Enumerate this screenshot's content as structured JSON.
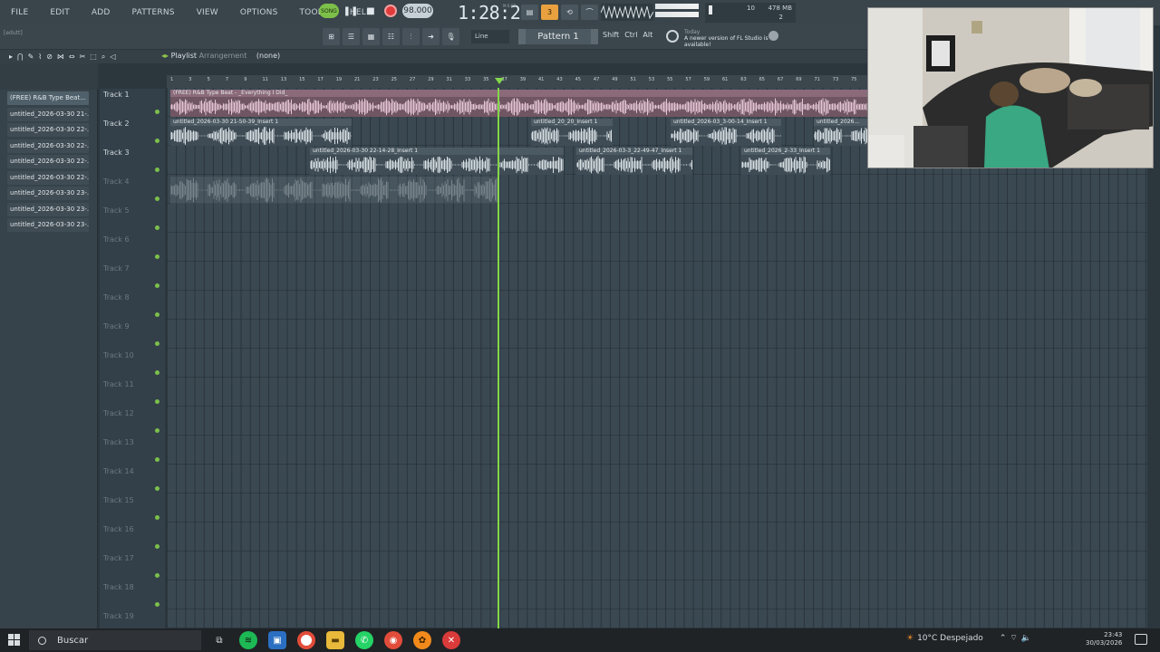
{
  "menu": [
    "FILE",
    "EDIT",
    "ADD",
    "PATTERNS",
    "VIEW",
    "OPTIONS",
    "TOOLS",
    "HELP"
  ],
  "transport": {
    "song_label": "SONG",
    "tempo": "98.000",
    "time": "1:28:27",
    "time_sub": "M:S:CS"
  },
  "cpu": {
    "cpu_value": "10",
    "memory": "478 MB",
    "polyphony": "2"
  },
  "hint_text": "[edutt]",
  "toolbar": {
    "line_mode": "Line",
    "pattern": "Pattern 1",
    "shift": "Shift",
    "ctrl": "Ctrl",
    "alt": "Alt"
  },
  "news": {
    "today": "Today",
    "message": "A newer version of FL Studio is available!"
  },
  "playlist": {
    "title": "Playlist",
    "subtitle": "Arrangement",
    "selection": "(none)"
  },
  "picker": [
    "(FREE) R&B Type Beat...",
    "untitled_2026-03-30 21-...",
    "untitled_2026-03-30 22-...",
    "untitled_2026-03-30 22-...",
    "untitled_2026-03-30 22-...",
    "untitled_2026-03-30 22-...",
    "untitled_2026-03-30 23-...",
    "untitled_2026-03-30 23-...",
    "untitled_2026-03-30 23-..."
  ],
  "tracks": [
    "Track 1",
    "Track 2",
    "Track 3",
    "Track 4",
    "Track 5",
    "Track 6",
    "Track 7",
    "Track 8",
    "Track 9",
    "Track 10",
    "Track 11",
    "Track 12",
    "Track 13",
    "Track 14",
    "Track 15",
    "Track 16",
    "Track 17",
    "Track 18",
    "Track 19"
  ],
  "ruler": [
    "1",
    "3",
    "5",
    "7",
    "9",
    "11",
    "13",
    "15",
    "17",
    "19",
    "21",
    "23",
    "25",
    "27",
    "29",
    "31",
    "33",
    "35",
    "37",
    "39",
    "41",
    "43",
    "45",
    "47",
    "49",
    "51",
    "53",
    "55",
    "57",
    "59",
    "61",
    "63",
    "65",
    "67",
    "69",
    "71",
    "73",
    "75"
  ],
  "clips": {
    "t1": "(FREE) R&B Type Beat - _Everything I Did_",
    "t2a": "untitled_2026-03-30 21-50-39_Insert 1",
    "t2b": "untitled_20_20_Insert 1",
    "t2c": "untitled_2026-03_3-00-14_Insert 1",
    "t2d": "untitled_2026...",
    "t3a": "untitled_2026-03-30 22-14-28_Insert 1",
    "t3b": "untitled_2026-03-3_22-49-47_Insert 1",
    "t3c": "untitled_2026_2-33_Insert 1"
  },
  "taskbar": {
    "search": "Buscar",
    "weather": "10°C  Despejado",
    "time": "23:43",
    "date": "30/03/2026"
  },
  "colors": {
    "accent_green": "#84d84a",
    "record_red": "#e23b3b",
    "clip_pink": "#8b6a7a"
  }
}
